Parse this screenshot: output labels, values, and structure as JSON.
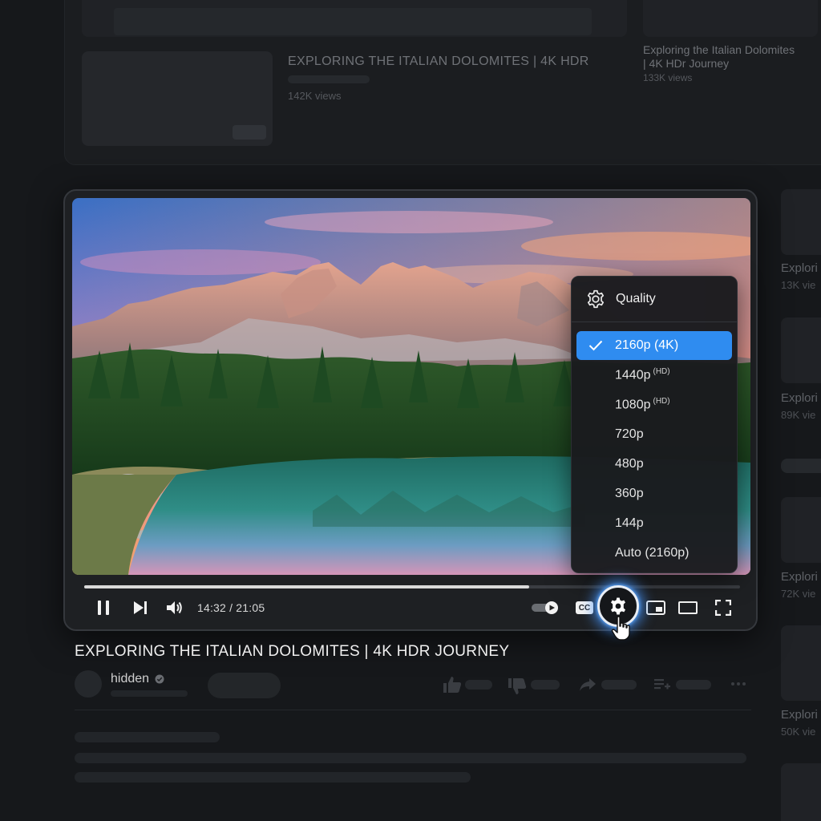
{
  "background_feed": {
    "top_card": {
      "title": "EXPLORING THE ITALIAN DOLOMITES  |  4K HDR",
      "views": "142K views"
    },
    "top_right_card": {
      "title_line1": "Exploring the Italian Dolomites",
      "title_line2": "| 4K HDr Journey",
      "views": "133K views"
    }
  },
  "player": {
    "current_time": "14:32",
    "duration": "21:05",
    "time_display": "14:32 / 21:05",
    "progress_fraction": 0.678,
    "cc_label": "CC",
    "accent_color": "#2f8cf0"
  },
  "quality_menu": {
    "title": "Quality",
    "options": [
      {
        "label": "2160p (4K)",
        "badge": "",
        "selected": true
      },
      {
        "label": "1440p",
        "badge": "HD",
        "selected": false
      },
      {
        "label": "1080p",
        "badge": "HD",
        "selected": false
      },
      {
        "label": "720p",
        "badge": "",
        "selected": false
      },
      {
        "label": "480p",
        "badge": "",
        "selected": false
      },
      {
        "label": "360p",
        "badge": "",
        "selected": false
      },
      {
        "label": "144p",
        "badge": "",
        "selected": false
      },
      {
        "label": "Auto (2160p)",
        "badge": "",
        "selected": false
      }
    ]
  },
  "video_info": {
    "title": "EXPLORING THE ITALIAN DOLOMITES | 4K HDR JOURNEY",
    "channel": "hidden"
  },
  "sidebar": {
    "items": [
      {
        "title": "Explori",
        "views": "13K vie"
      },
      {
        "title": "Explori",
        "views": "89K vie"
      },
      {
        "title": "Explori",
        "views": "72K vie"
      },
      {
        "title": "Explori",
        "views": "50K vie"
      }
    ]
  },
  "icons": [
    "pause-icon",
    "next-icon",
    "volume-icon",
    "autoplay-toggle",
    "cc-icon",
    "gear-icon",
    "miniplayer-icon",
    "theater-icon",
    "fullscreen-icon",
    "check-icon",
    "verified-icon",
    "like-icon",
    "dislike-icon",
    "share-icon",
    "save-icon",
    "more-icon",
    "cursor-hand-icon"
  ]
}
